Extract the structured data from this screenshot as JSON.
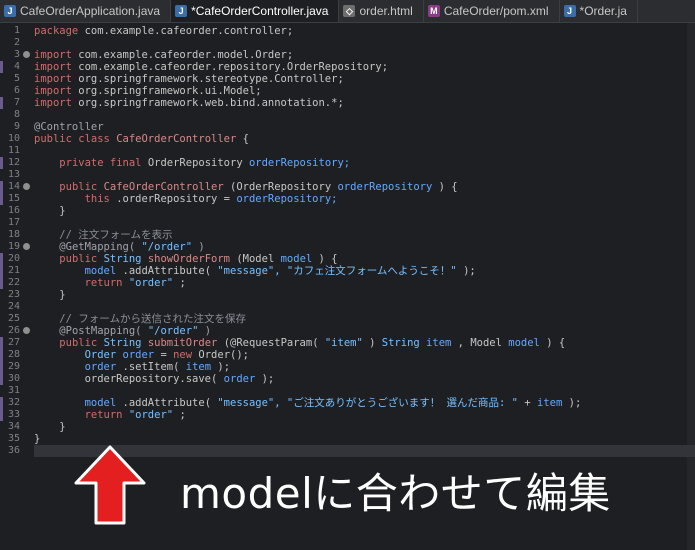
{
  "tabs": [
    {
      "label": "CafeOrderApplication.java",
      "icon": "java-file-icon",
      "active": false
    },
    {
      "label": "*CafeOrderController.java",
      "icon": "java-file-icon",
      "active": true
    },
    {
      "label": "order.html",
      "icon": "html-file-icon",
      "active": false
    },
    {
      "label": "CafeOrder/pom.xml",
      "icon": "maven-file-icon",
      "active": false
    },
    {
      "label": "*Order.ja",
      "icon": "java-file-icon",
      "active": false
    }
  ],
  "editor": {
    "lines": [
      {
        "n": "1",
        "segs": [
          [
            "kw",
            "package"
          ],
          [
            "",
            "com.example.cafeorder.controller;"
          ]
        ]
      },
      {
        "n": "2",
        "segs": []
      },
      {
        "n": "3",
        "segs": [
          [
            "kw",
            "import"
          ],
          [
            "",
            "com.example.cafeorder.model.Order;"
          ]
        ]
      },
      {
        "n": "4",
        "segs": [
          [
            "kw",
            "import"
          ],
          [
            "",
            "com.example.cafeorder.repository.OrderRepository;"
          ]
        ]
      },
      {
        "n": "5",
        "segs": [
          [
            "kw",
            "import"
          ],
          [
            "",
            "org.springframework.stereotype.Controller;"
          ]
        ]
      },
      {
        "n": "6",
        "segs": [
          [
            "kw",
            "import"
          ],
          [
            "",
            "org.springframework.ui.Model;"
          ]
        ]
      },
      {
        "n": "7",
        "segs": [
          [
            "kw",
            "import"
          ],
          [
            "",
            "org.springframework.web.bind.annotation.*;"
          ]
        ]
      },
      {
        "n": "8",
        "segs": []
      },
      {
        "n": "9",
        "segs": [
          [
            "ann",
            "@Controller"
          ]
        ]
      },
      {
        "n": "10",
        "segs": [
          [
            "kw",
            "public class"
          ],
          [
            "fn",
            "CafeOrderController"
          ],
          [
            "",
            "{"
          ]
        ]
      },
      {
        "n": "11",
        "segs": []
      },
      {
        "n": "12",
        "segs": [
          [
            "ind",
            "    "
          ],
          [
            "kw",
            "private final"
          ],
          [
            "",
            "OrderRepository"
          ],
          [
            "fld",
            "orderRepository;"
          ]
        ]
      },
      {
        "n": "13",
        "segs": []
      },
      {
        "n": "14",
        "segs": [
          [
            "ind",
            "    "
          ],
          [
            "kw",
            "public"
          ],
          [
            "fn",
            "CafeOrderController"
          ],
          [
            "",
            "(OrderRepository"
          ],
          [
            "fld",
            "orderRepository"
          ],
          [
            "",
            ") {"
          ]
        ]
      },
      {
        "n": "15",
        "segs": [
          [
            "ind",
            "        "
          ],
          [
            "kw",
            "this"
          ],
          [
            "",
            ".orderRepository ="
          ],
          [
            "fld",
            "orderRepository;"
          ]
        ]
      },
      {
        "n": "16",
        "segs": [
          [
            "ind",
            "    "
          ],
          [
            "",
            "}"
          ]
        ]
      },
      {
        "n": "17",
        "segs": []
      },
      {
        "n": "18",
        "segs": [
          [
            "ind",
            "    "
          ],
          [
            "cmt",
            "// 注文フォームを表示"
          ]
        ]
      },
      {
        "n": "19",
        "segs": [
          [
            "ind",
            "    "
          ],
          [
            "ann",
            "@GetMapping("
          ],
          [
            "str",
            "\"/order\""
          ],
          [
            "ann",
            ")"
          ]
        ]
      },
      {
        "n": "20",
        "segs": [
          [
            "ind",
            "    "
          ],
          [
            "kw",
            "public"
          ],
          [
            "str",
            "String"
          ],
          [
            "fn",
            "showOrderForm"
          ],
          [
            "",
            "(Model"
          ],
          [
            "fld",
            "model"
          ],
          [
            "",
            ") {"
          ]
        ]
      },
      {
        "n": "21",
        "segs": [
          [
            "ind",
            "        "
          ],
          [
            "fld",
            "model"
          ],
          [
            "",
            ".addAttribute("
          ],
          [
            "str",
            "\"message\", \"カフェ注文フォームへようこそ！\""
          ],
          [
            "",
            ");"
          ]
        ]
      },
      {
        "n": "22",
        "segs": [
          [
            "ind",
            "        "
          ],
          [
            "kw",
            "return"
          ],
          [
            "str",
            "\"order\""
          ],
          [
            "",
            ";"
          ]
        ]
      },
      {
        "n": "23",
        "segs": [
          [
            "ind",
            "    "
          ],
          [
            "",
            "}"
          ]
        ]
      },
      {
        "n": "24",
        "segs": []
      },
      {
        "n": "25",
        "segs": [
          [
            "ind",
            "    "
          ],
          [
            "cmt",
            "// フォームから送信された注文を保存"
          ]
        ]
      },
      {
        "n": "26",
        "segs": [
          [
            "ind",
            "    "
          ],
          [
            "ann",
            "@PostMapping("
          ],
          [
            "str",
            "\"/order\""
          ],
          [
            "ann",
            ")"
          ]
        ]
      },
      {
        "n": "27",
        "segs": [
          [
            "ind",
            "    "
          ],
          [
            "kw",
            "public"
          ],
          [
            "str",
            "String"
          ],
          [
            "fn",
            "submitOrder"
          ],
          [
            "",
            "(@RequestParam("
          ],
          [
            "str",
            "\"item\""
          ],
          [
            "",
            ")"
          ],
          [
            "str",
            "String"
          ],
          [
            "fld",
            "item"
          ],
          [
            "",
            ", Model"
          ],
          [
            "fld",
            "model"
          ],
          [
            "",
            ") {"
          ]
        ]
      },
      {
        "n": "28",
        "segs": [
          [
            "ind",
            "        "
          ],
          [
            "str",
            "Order"
          ],
          [
            "fld",
            "order"
          ],
          [
            "",
            "="
          ],
          [
            "kw",
            "new"
          ],
          [
            "",
            "Order();"
          ]
        ]
      },
      {
        "n": "29",
        "segs": [
          [
            "ind",
            "        "
          ],
          [
            "fld",
            "order"
          ],
          [
            "",
            ".setItem("
          ],
          [
            "fld",
            "item"
          ],
          [
            "",
            ");"
          ]
        ]
      },
      {
        "n": "30",
        "segs": [
          [
            "ind",
            "        "
          ],
          [
            "",
            "orderRepository.save("
          ],
          [
            "fld",
            "order"
          ],
          [
            "",
            ");"
          ]
        ]
      },
      {
        "n": "31",
        "segs": []
      },
      {
        "n": "32",
        "segs": [
          [
            "ind",
            "        "
          ],
          [
            "fld",
            "model"
          ],
          [
            "",
            ".addAttribute("
          ],
          [
            "str",
            "\"message\", \"ご注文ありがとうございます！ 選んだ商品: \""
          ],
          [
            "",
            "+"
          ],
          [
            "fld",
            "item"
          ],
          [
            "",
            ");"
          ]
        ]
      },
      {
        "n": "33",
        "segs": [
          [
            "ind",
            "        "
          ],
          [
            "kw",
            "return"
          ],
          [
            "str",
            "\"order\""
          ],
          [
            "",
            ";"
          ]
        ]
      },
      {
        "n": "34",
        "segs": [
          [
            "ind",
            "    "
          ],
          [
            "",
            "}"
          ]
        ]
      },
      {
        "n": "35",
        "segs": [
          [
            "",
            "}"
          ]
        ]
      },
      {
        "n": "36",
        "segs": []
      }
    ],
    "markers": [
      "4",
      "7",
      "12",
      "14",
      "15",
      "20",
      "21",
      "22",
      "27",
      "28",
      "29",
      "30",
      "32",
      "33"
    ],
    "folds": [
      "3",
      "14",
      "19",
      "26"
    ],
    "current_line": "36"
  },
  "overlay": {
    "caption": "modelに合わせて編集",
    "arrow": "up-arrow-icon",
    "arrow_color": "#e3201f"
  }
}
